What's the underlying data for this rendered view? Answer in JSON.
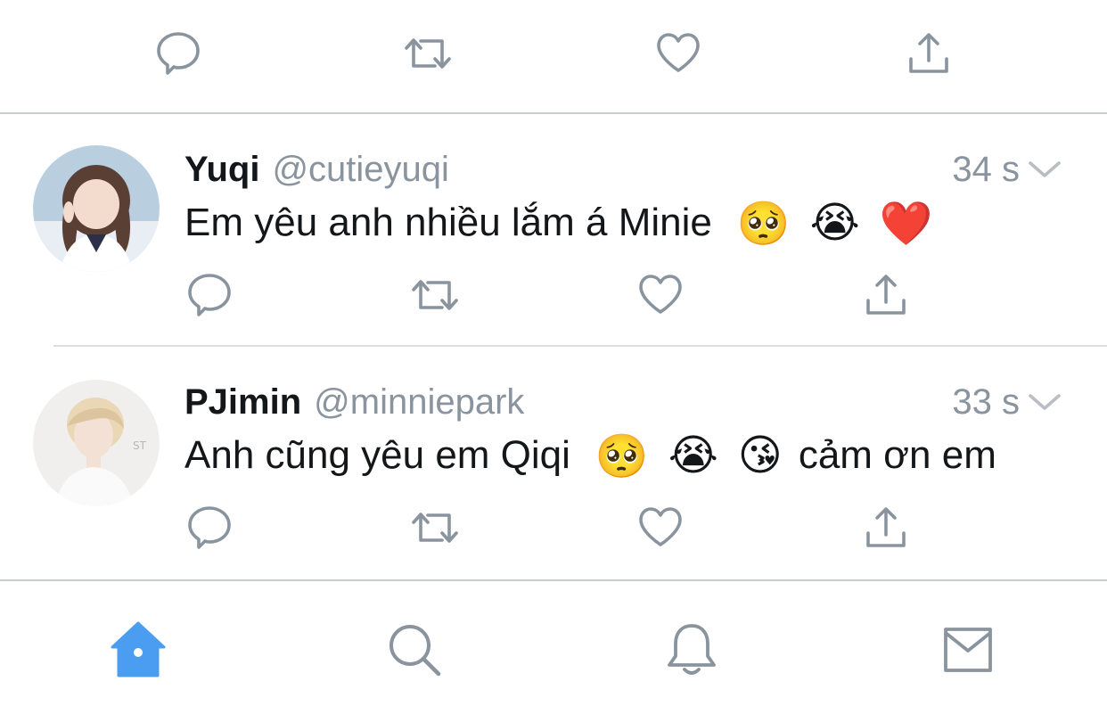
{
  "tweets": [
    {
      "display_name": "Yuqi",
      "handle": "@cutieyuqi",
      "time": "34 s",
      "text": "Em yêu anh nhiều lắm á Minie",
      "emojis": [
        "🥺",
        "😭",
        "❤️"
      ],
      "text_after": ""
    },
    {
      "display_name": "PJimin",
      "handle": "@minniepark",
      "time": "33 s",
      "text": "Anh cũng yêu em Qiqi",
      "emojis": [
        "🥺",
        "😭",
        "😘"
      ],
      "text_after": "cảm ơn em"
    }
  ],
  "icons": {
    "actions": [
      "reply-icon",
      "retweet-icon",
      "like-icon",
      "share-icon"
    ],
    "tabs": [
      "home-icon",
      "search-icon",
      "notifications-icon",
      "messages-icon"
    ]
  },
  "colors": {
    "accent": "#4a9df0",
    "icon_gray": "#8a949e",
    "text": "#14171a",
    "secondary_text": "#8a949e"
  },
  "active_tab": "home"
}
